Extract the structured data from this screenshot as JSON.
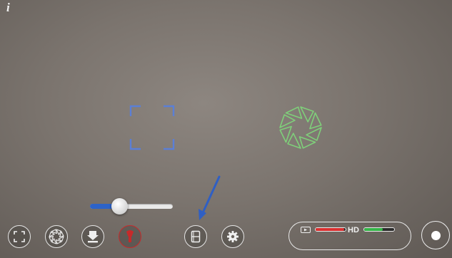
{
  "overlay": {
    "info_icon": "info-icon",
    "focus_color": "#5b7fd6",
    "exposure_color": "#7fcf7a",
    "arrow_color": "#2f5fc4"
  },
  "zoom": {
    "level": 0.35,
    "fill_color": "#2d63c8"
  },
  "toolbar": {
    "buttons": [
      {
        "name": "fullscreen-button",
        "icon": "fullscreen-icon",
        "active": false
      },
      {
        "name": "exposure-button",
        "icon": "aperture-icon",
        "active": false
      },
      {
        "name": "white-balance-button",
        "icon": "white-balance-icon",
        "active": false
      },
      {
        "name": "flash-button",
        "icon": "flashlight-icon",
        "active": true,
        "accent": "#c62a2a"
      },
      {
        "name": "media-library-button",
        "icon": "film-icon",
        "active": false
      },
      {
        "name": "settings-button",
        "icon": "gear-icon",
        "active": false
      }
    ]
  },
  "status": {
    "quality_label": "HD",
    "storage_level": 0.95,
    "storage_color": "#d93030",
    "battery_level": 0.62,
    "battery_color": "#35b548"
  },
  "record": {
    "icon": "record-icon"
  }
}
